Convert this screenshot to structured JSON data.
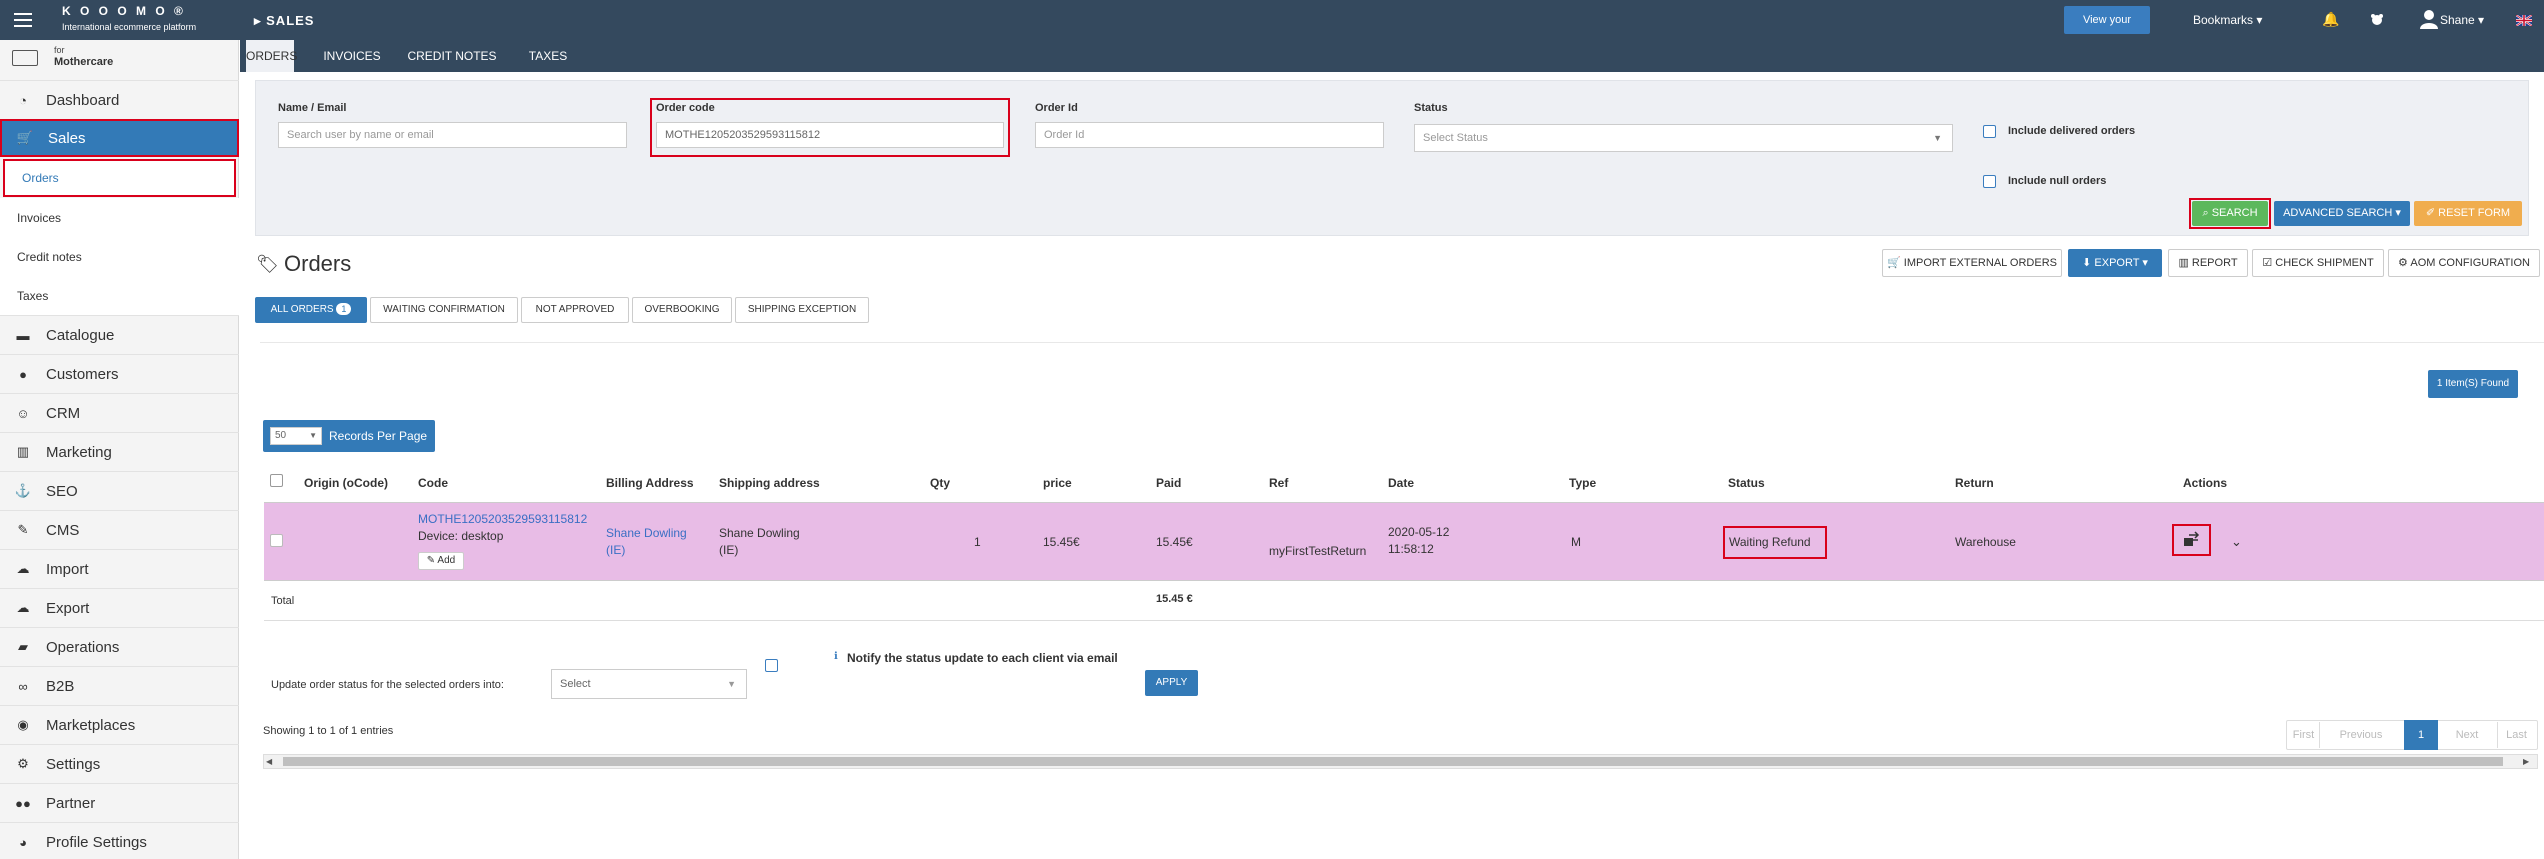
{
  "topbar": {
    "logo_name": "K O O O M O ®",
    "logo_tagline": "International ecommerce platform",
    "section": "SALES",
    "view_website": "View your website",
    "bookmarks": "Bookmarks",
    "user": "Shane"
  },
  "sidebar": {
    "brand_for": "for",
    "brand_name": "Mothercare",
    "items": [
      {
        "label": "Dashboard",
        "icon": "dashboard-icon"
      },
      {
        "label": "Sales",
        "icon": "cart-icon"
      },
      {
        "label": "Orders"
      },
      {
        "label": "Invoices"
      },
      {
        "label": "Credit notes"
      },
      {
        "label": "Taxes"
      },
      {
        "label": "Catalogue",
        "icon": "archive-icon"
      },
      {
        "label": "Customers",
        "icon": "user-icon"
      },
      {
        "label": "CRM",
        "icon": "smile-icon"
      },
      {
        "label": "Marketing",
        "icon": "megaphone-icon"
      },
      {
        "label": "SEO",
        "icon": "anchor-icon"
      },
      {
        "label": "CMS",
        "icon": "edit-icon"
      },
      {
        "label": "Import",
        "icon": "cloud-upload-icon"
      },
      {
        "label": "Export",
        "icon": "cloud-download-icon"
      },
      {
        "label": "Operations",
        "icon": "truck-icon"
      },
      {
        "label": "B2B",
        "icon": "handshake-icon"
      },
      {
        "label": "Marketplaces",
        "icon": "globe-icon"
      },
      {
        "label": "Settings",
        "icon": "gear-icon"
      },
      {
        "label": "Partner",
        "icon": "users-icon"
      },
      {
        "label": "Profile Settings",
        "icon": "user-circle-icon"
      }
    ]
  },
  "tabs": [
    "ORDERS",
    "INVOICES",
    "CREDIT NOTES",
    "TAXES"
  ],
  "filters": {
    "name_label": "Name / Email",
    "name_placeholder": "Search user by name or email",
    "code_label": "Order code",
    "code_value": "MOTHE1205203529593115812",
    "id_label": "Order Id",
    "id_placeholder": "Order Id",
    "status_label": "Status",
    "status_placeholder": "Select Status",
    "include_delivered": "Include delivered orders",
    "include_null": "Include null orders",
    "search": "SEARCH",
    "advanced": "ADVANCED SEARCH",
    "reset": "RESET FORM"
  },
  "orders": {
    "title": "Orders",
    "toolbar": [
      "IMPORT EXTERNAL ORDERS",
      "EXPORT",
      "REPORT",
      "CHECK SHIPMENT",
      "AOM CONFIGURATION"
    ],
    "filter_tabs": [
      "ALL ORDERS",
      "WAITING CONFIRMATION",
      "NOT APPROVED",
      "OVERBOOKING",
      "SHIPPING EXCEPTION"
    ],
    "all_count": "1",
    "found": "1 Item(S) Found",
    "per_page_value": "50",
    "per_page_label": "Records Per Page",
    "columns": [
      "Origin (oCode)",
      "Code",
      "Billing Address",
      "Shipping address",
      "Qty",
      "price",
      "Paid",
      "Ref",
      "Date",
      "Type",
      "Status",
      "Return",
      "Actions"
    ],
    "row": {
      "code": "MOTHE1205203529593115812",
      "device": "Device: desktop",
      "add": "Add",
      "billing_name": "Shane Dowling",
      "billing_country": "(IE)",
      "shipping_name": "Shane Dowling",
      "shipping_country": "(IE)",
      "qty": "1",
      "price": "15.45€",
      "paid": "15.45€",
      "ref": "myFirstTestReturn",
      "date": "2020-05-12",
      "time": "11:58:12",
      "type": "M",
      "status": "Waiting Refund",
      "return": "Warehouse"
    },
    "total_label": "Total",
    "total_value": "15.45 €",
    "update_label": "Update order status for the selected orders into:",
    "select_placeholder": "Select",
    "notify": "Notify the status update to each client via email",
    "apply": "APPLY",
    "showing": "Showing 1 to 1 of 1 entries",
    "pager": [
      "First",
      "Previous",
      "1",
      "Next",
      "Last"
    ]
  },
  "colors": {
    "topbar": "#34495e",
    "primary": "#337ab7",
    "success": "#5cb85c",
    "warning": "#f0ad4e",
    "row_highlight": "#e8bce6",
    "annotation": "#d9001b"
  }
}
